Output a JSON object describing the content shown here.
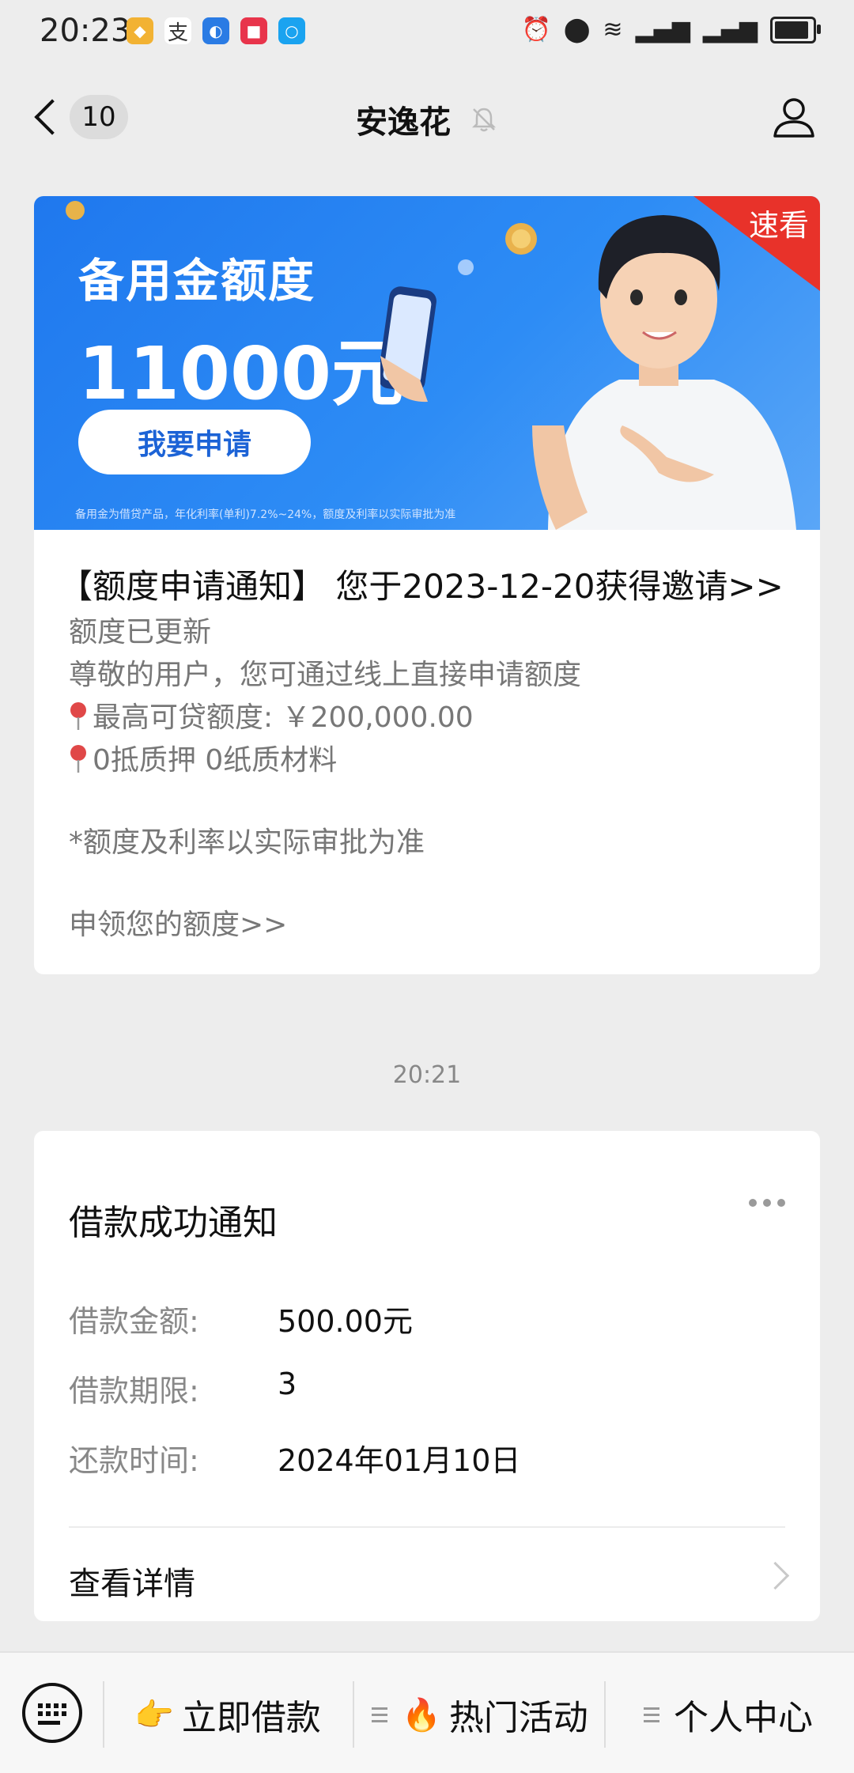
{
  "status_bar": {
    "time": "20:23"
  },
  "nav": {
    "title": "安逸花",
    "unread_count": "10"
  },
  "banner": {
    "title": "备用金额度",
    "amount": "11000元",
    "button": "我要申请",
    "corner_tag": "速看",
    "fine_print": "备用金为借贷产品，年化利率(单利)7.2%~24%，额度及利率以实际审批为准"
  },
  "message1": {
    "headline": "【额度申请通知】 您于2023-12-20获得邀请>>",
    "line1": "额度已更新",
    "line2": "尊敬的用户，您可通过线上直接申请额度",
    "line3": "最高可贷额度: ￥200,000.00",
    "line4": "0抵质押 0纸质材料",
    "line5": "*额度及利率以实际审批为准",
    "line6": "申领您的额度>>"
  },
  "timestamp": "20:21",
  "message2": {
    "title": "借款成功通知",
    "rows": [
      {
        "label": "借款金额:",
        "value": "500.00元"
      },
      {
        "label": "借款期限:",
        "value": "3"
      },
      {
        "label": "还款时间:",
        "value": "2024年01月10日"
      }
    ],
    "detail_link": "查看详情"
  },
  "bottom_menu": {
    "items": [
      {
        "emoji": "👉",
        "label": "立即借款"
      },
      {
        "emoji": "🔥",
        "label": "热门活动"
      },
      {
        "emoji": "",
        "label": "个人中心"
      }
    ]
  },
  "icons": [
    "keyboard-icon",
    "back-icon",
    "muted-bell-icon",
    "profile-icon",
    "pin-icon",
    "more-icon",
    "chevron-right-icon"
  ]
}
